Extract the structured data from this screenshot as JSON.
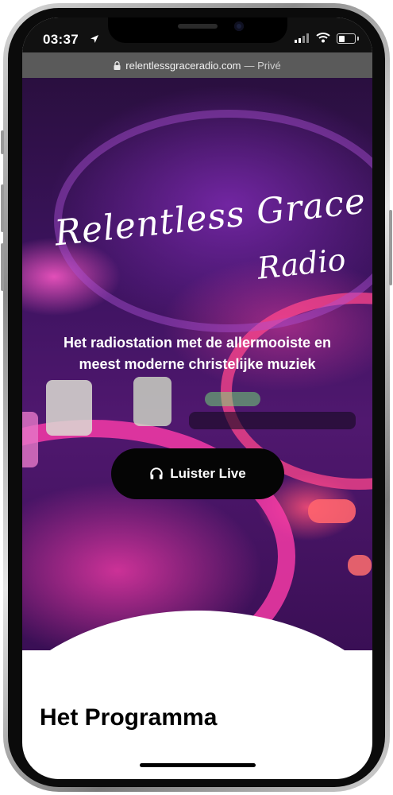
{
  "status_bar": {
    "time": "03:37",
    "location_icon": "location-arrow-icon",
    "signal_icon": "cellular-signal-icon",
    "wifi_icon": "wifi-icon",
    "battery_icon": "battery-icon"
  },
  "browser": {
    "url_host": "relentlessgraceradio.com",
    "url_suffix": "— Privé",
    "lock_icon": "lock-icon"
  },
  "hero": {
    "logo_line1": "Relentless Grace",
    "logo_line2": "Radio",
    "tagline": "Het radiostation met de allermooiste en meest moderne christelijke muziek",
    "listen_button": {
      "icon": "headphones-icon",
      "label": "Luister Live"
    }
  },
  "main": {
    "section_title": "Het Programma"
  },
  "colors": {
    "status_bar_bg": "#111111",
    "url_bar_bg": "#5a5a5a",
    "button_bg": "#050505",
    "hero_accent": "#e83ca0"
  }
}
